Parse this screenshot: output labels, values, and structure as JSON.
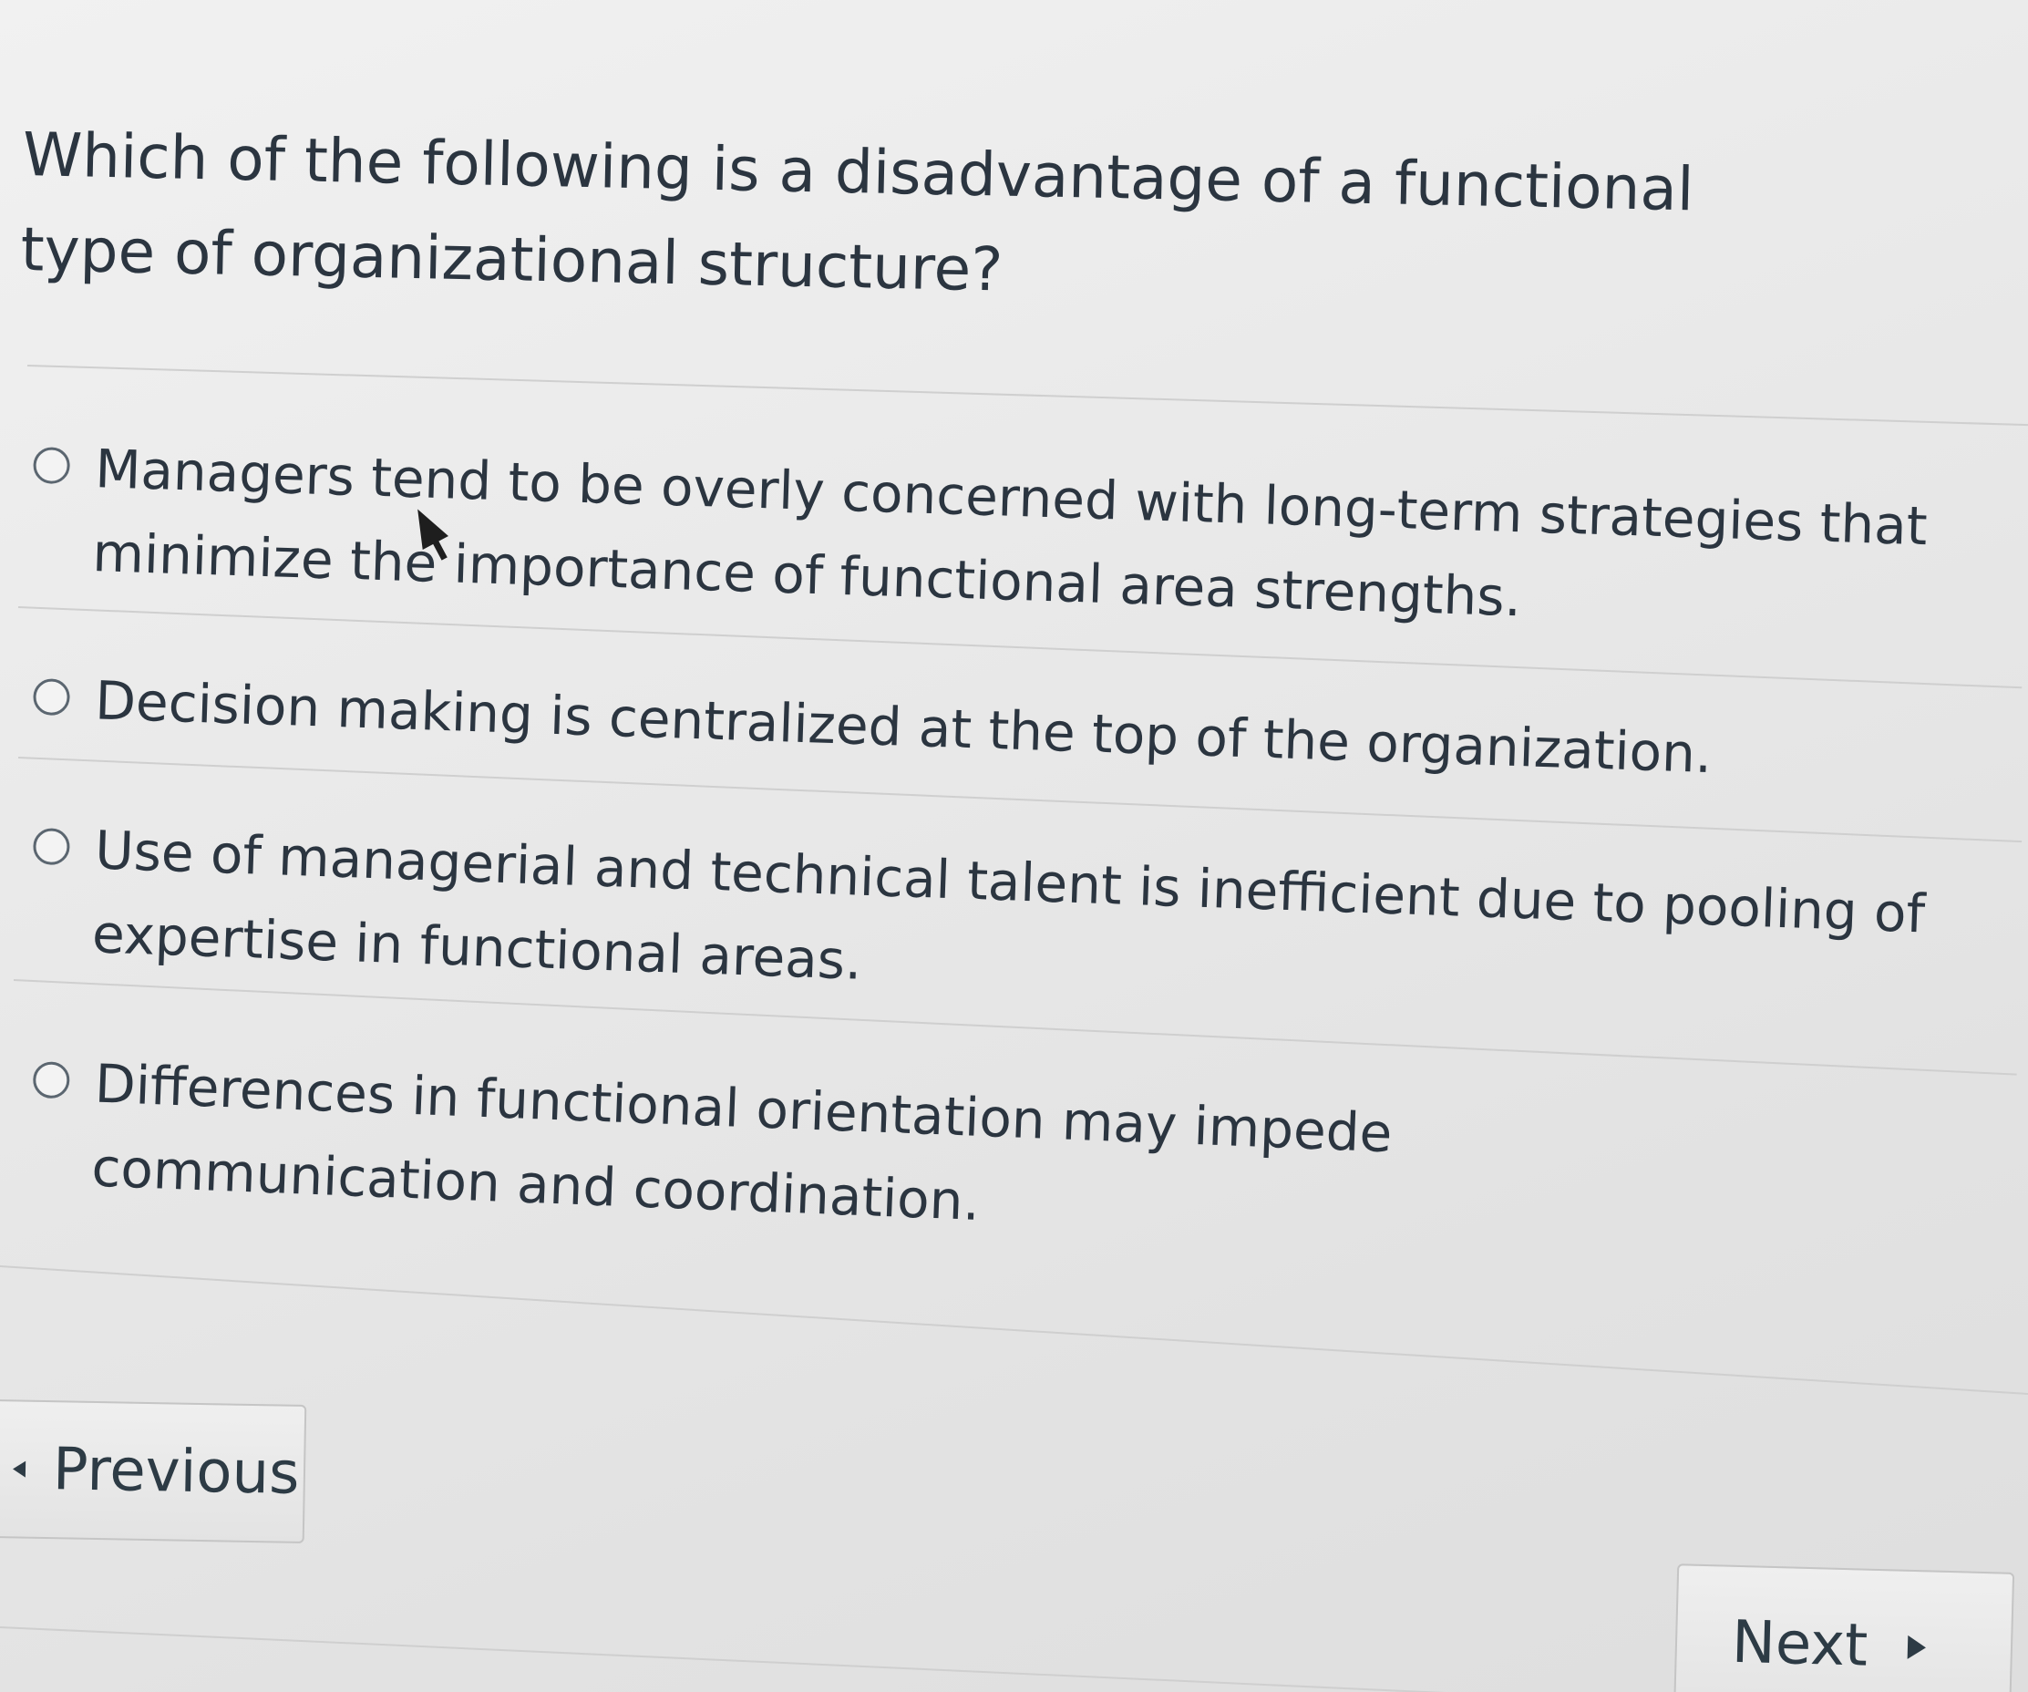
{
  "question": {
    "text": "Which of the following is a disadvantage of a functional type of organizational structure?"
  },
  "answers": [
    {
      "label": "Managers tend to be overly concerned with long-term strategies that minimize the importance of functional area strengths."
    },
    {
      "label": "Decision making is centralized at the top of the organization."
    },
    {
      "label": "Use of managerial and technical talent is inefficient due to pooling of expertise in functional areas."
    },
    {
      "label": "Differences in functional orientation may impede communication and coordination."
    }
  ],
  "navigation": {
    "previous_label": "Previous",
    "next_label": "Next"
  },
  "icons": {
    "radio": "radio-unselected-icon",
    "previous": "triangle-left-icon",
    "next": "triangle-right-icon",
    "cursor": "mouse-pointer-icon"
  }
}
